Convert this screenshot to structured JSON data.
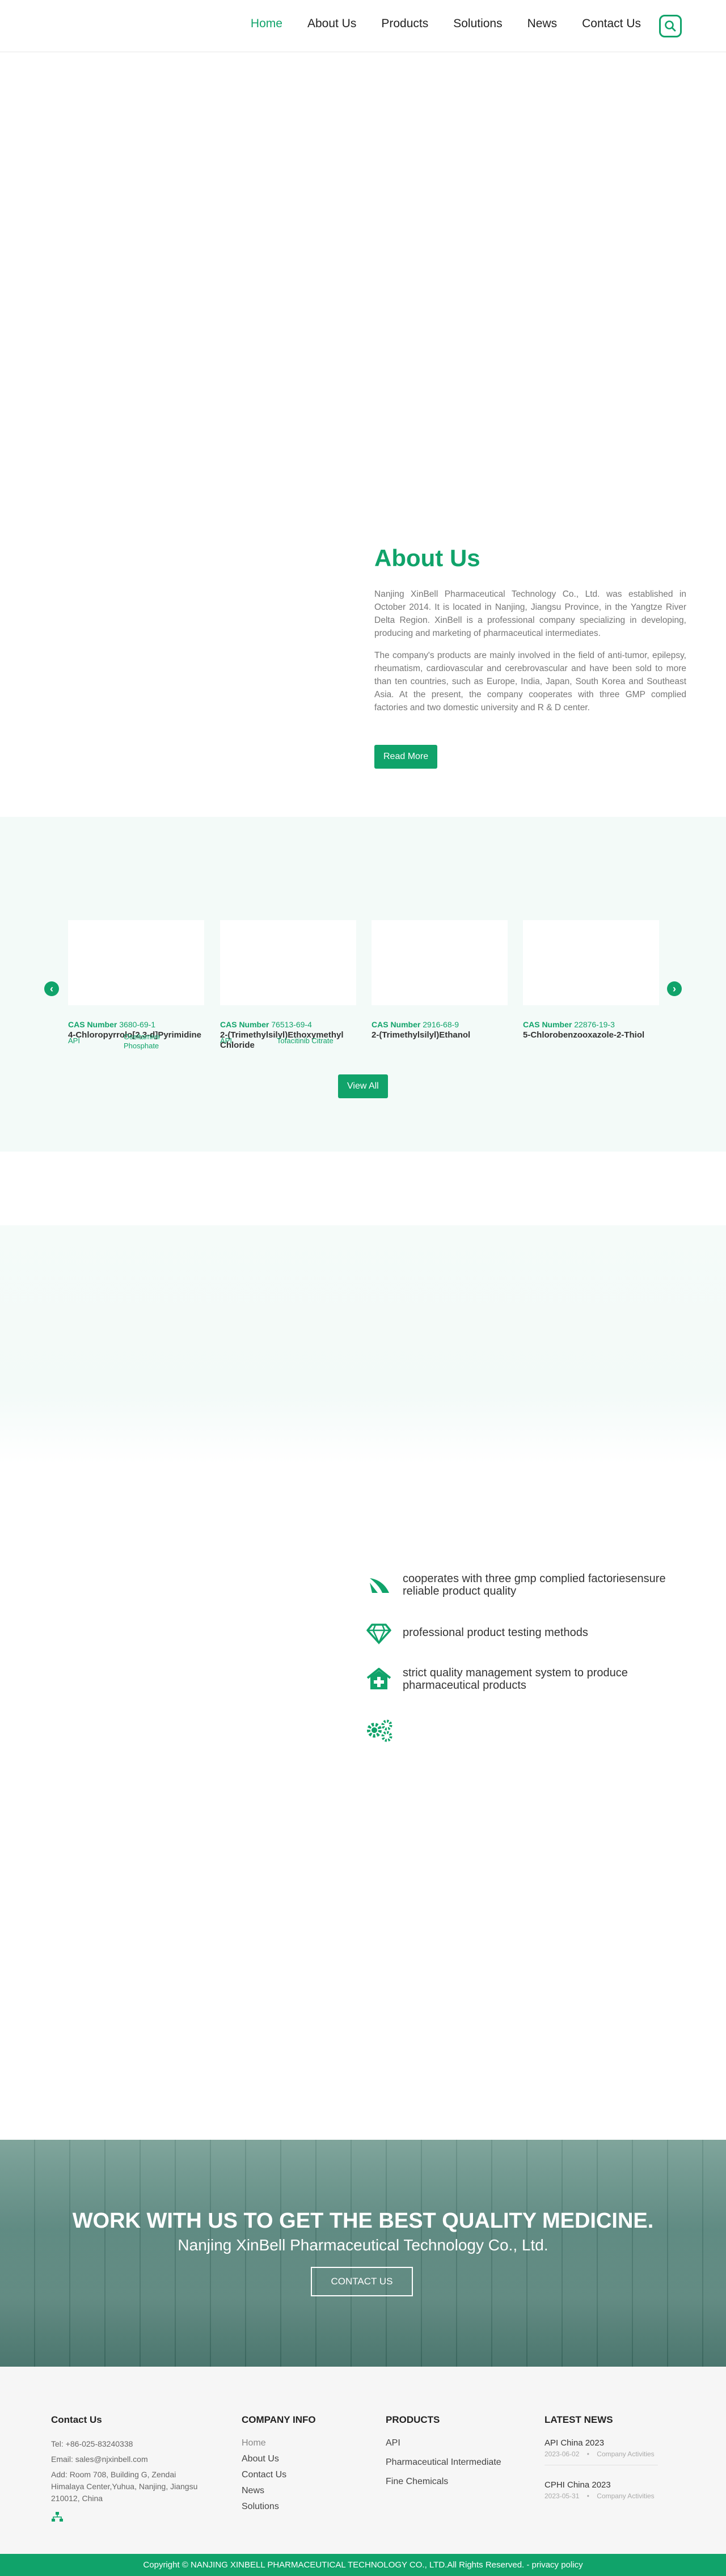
{
  "nav": {
    "items": [
      "Home",
      "About Us",
      "Products",
      "Solutions",
      "News",
      "Contact Us"
    ],
    "active": "Home",
    "search_icon": "search-icon"
  },
  "about": {
    "title": "About Us",
    "p1": "Nanjing XinBell Pharmaceutical Technology Co., Ltd. was established in October 2014. It is located in Nanjing, Jiangsu Province, in the Yangtze River Delta Region. XinBell is a professional company specializing in developing, producing and marketing of pharmaceutical intermediates.",
    "p2": "The company's products are mainly involved in the field of anti-tumor, epilepsy, rheumatism, cardiovascular and cerebrovascular and have been sold to more than ten countries, such as Europe, India, Japan, South Korea and Southeast Asia. At the present, the company cooperates with three GMP complied factories and two domestic university and R & D center.",
    "button": "Read More"
  },
  "products": {
    "cas_label": "CAS Number",
    "items": [
      {
        "cas": "3680-69-1",
        "name": "4-Chloropyrrolo[2,3-d]Pyrimidine"
      },
      {
        "cas": "76513-69-4",
        "name": "2-(Trimethylsilyl)Ethoxymethyl Chloride"
      },
      {
        "cas": "2916-68-9",
        "name": "2-(Trimethylsilyl)Ethanol"
      },
      {
        "cas": "22876-19-3",
        "name": "5-Chlorobenzooxazole-2-Thiol"
      }
    ],
    "tags": {
      "api": "API",
      "oseltamivir_a": "Oseltamivir",
      "oseltamivir_b": "Phosphate",
      "api2": "API",
      "tofacitinib": "Tofacitinib Citrate"
    },
    "prev_icon": "chevron-left-icon",
    "next_icon": "chevron-right-icon",
    "button": "View All"
  },
  "features": [
    {
      "icon": "leaf-icon",
      "text": "cooperates with three gmp complied factoriesensure reliable product quality"
    },
    {
      "icon": "diamond-icon",
      "text": "professional product testing methods"
    },
    {
      "icon": "medical-house-icon",
      "text": "strict quality management system to produce pharmaceutical products"
    }
  ],
  "gears_icon": "gears-icon",
  "cta": {
    "title": "WORK WITH US TO GET THE BEST QUALITY MEDICINE.",
    "subtitle": "Nanjing XinBell Pharmaceutical Technology Co., Ltd.",
    "button": "CONTACT US"
  },
  "footer": {
    "contact": {
      "heading": "Contact Us",
      "tel": "Tel: +86-025-83240338",
      "email": "Email: sales@njxinbell.com",
      "addr": "Add: Room 708, Building G, Zendai Himalaya Center,Yuhua, Nanjing, Jiangsu 210012, China",
      "sitemap_icon": "sitemap-icon"
    },
    "company": {
      "heading": "COMPANY INFO",
      "links": [
        "Home",
        "About Us",
        "Contact Us",
        "News",
        "Solutions"
      ]
    },
    "products": {
      "heading": "PRODUCTS",
      "links": [
        "API",
        "Pharmaceutical Intermediate",
        "Fine Chemicals"
      ]
    },
    "news": {
      "heading": "LATEST NEWS",
      "items": [
        {
          "title": "API China 2023",
          "date": "2023-06-02",
          "category": "Company Activities"
        },
        {
          "title": "CPHI China 2023",
          "date": "2023-05-31",
          "category": "Company Activities"
        }
      ]
    }
  },
  "copyright": "Copyright © NANJING XINBELL PHARMACEUTICAL TECHNOLOGY CO., LTD.All Rights Reserved. - privacy policy",
  "colors": {
    "brand": "#10a36a",
    "band": "#f3faf8"
  }
}
